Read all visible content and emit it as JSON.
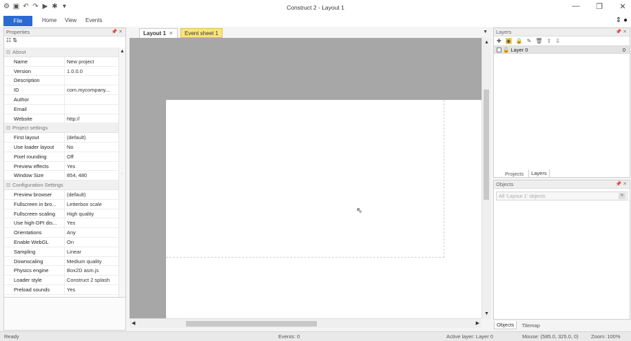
{
  "window": {
    "title": "Construct 2 - Layout 1"
  },
  "quick_access": [
    "gear-icon",
    "save-icon",
    "undo-icon",
    "redo-icon",
    "preview-icon",
    "debug-icon",
    "customize-icon"
  ],
  "ribbon": {
    "file": "File",
    "tabs": [
      "Home",
      "View",
      "Events"
    ]
  },
  "properties": {
    "title": "Properties",
    "sections": [
      {
        "title": "About",
        "rows": [
          {
            "key": "Name",
            "value": "New project"
          },
          {
            "key": "Version",
            "value": "1.0.0.0"
          },
          {
            "key": "Description",
            "value": ""
          },
          {
            "key": "ID",
            "value": "com.mycompany..."
          },
          {
            "key": "Author",
            "value": ""
          },
          {
            "key": "Email",
            "value": ""
          },
          {
            "key": "Website",
            "value": "http://"
          }
        ]
      },
      {
        "title": "Project settings",
        "rows": [
          {
            "key": "First layout",
            "value": "(default)"
          },
          {
            "key": "Use loader layout",
            "value": "No"
          },
          {
            "key": "Pixel rounding",
            "value": "Off"
          },
          {
            "key": "Preview effects",
            "value": "Yes"
          },
          {
            "key": "Window Size",
            "value": "854, 480"
          }
        ]
      },
      {
        "title": "Configuration Settings",
        "rows": [
          {
            "key": "Preview browser",
            "value": "(default)"
          },
          {
            "key": "Fullscreen in bro...",
            "value": "Letterbox scale"
          },
          {
            "key": "Fullscreen scaling",
            "value": "High quality"
          },
          {
            "key": "Use high-DPI dis...",
            "value": "Yes"
          },
          {
            "key": "Orientations",
            "value": "Any"
          },
          {
            "key": "Enable WebGL",
            "value": "On"
          },
          {
            "key": "Sampling",
            "value": "Linear"
          },
          {
            "key": "Downscaling",
            "value": "Medium quality"
          },
          {
            "key": "Physics engine",
            "value": "Box2D asm.js"
          },
          {
            "key": "Loader style",
            "value": "Construct 2 splash"
          },
          {
            "key": "Preload sounds",
            "value": "Yes"
          }
        ]
      }
    ]
  },
  "doc_tabs": {
    "layout": "Layout 1",
    "event_sheet": "Event sheet 1"
  },
  "layers": {
    "title": "Layers",
    "items": [
      {
        "name": "Layer 0",
        "index": "0"
      }
    ],
    "tabs": [
      "Projects",
      "Layers"
    ]
  },
  "objects": {
    "title": "Objects",
    "search_placeholder": "All 'Layout 1' objects",
    "tabs": [
      "Objects",
      "Tilemap"
    ]
  },
  "status": {
    "ready": "Ready",
    "events": "Events: 0",
    "active_layer": "Active layer: Layer 0",
    "mouse": "Mouse: (585.0, 325.0, 0)",
    "zoom": "Zoom: 100%"
  },
  "colors": {
    "file_tab": "#2a6ad2",
    "event_tab": "#fbe57b",
    "canvas_bg": "#a7a7a7"
  }
}
